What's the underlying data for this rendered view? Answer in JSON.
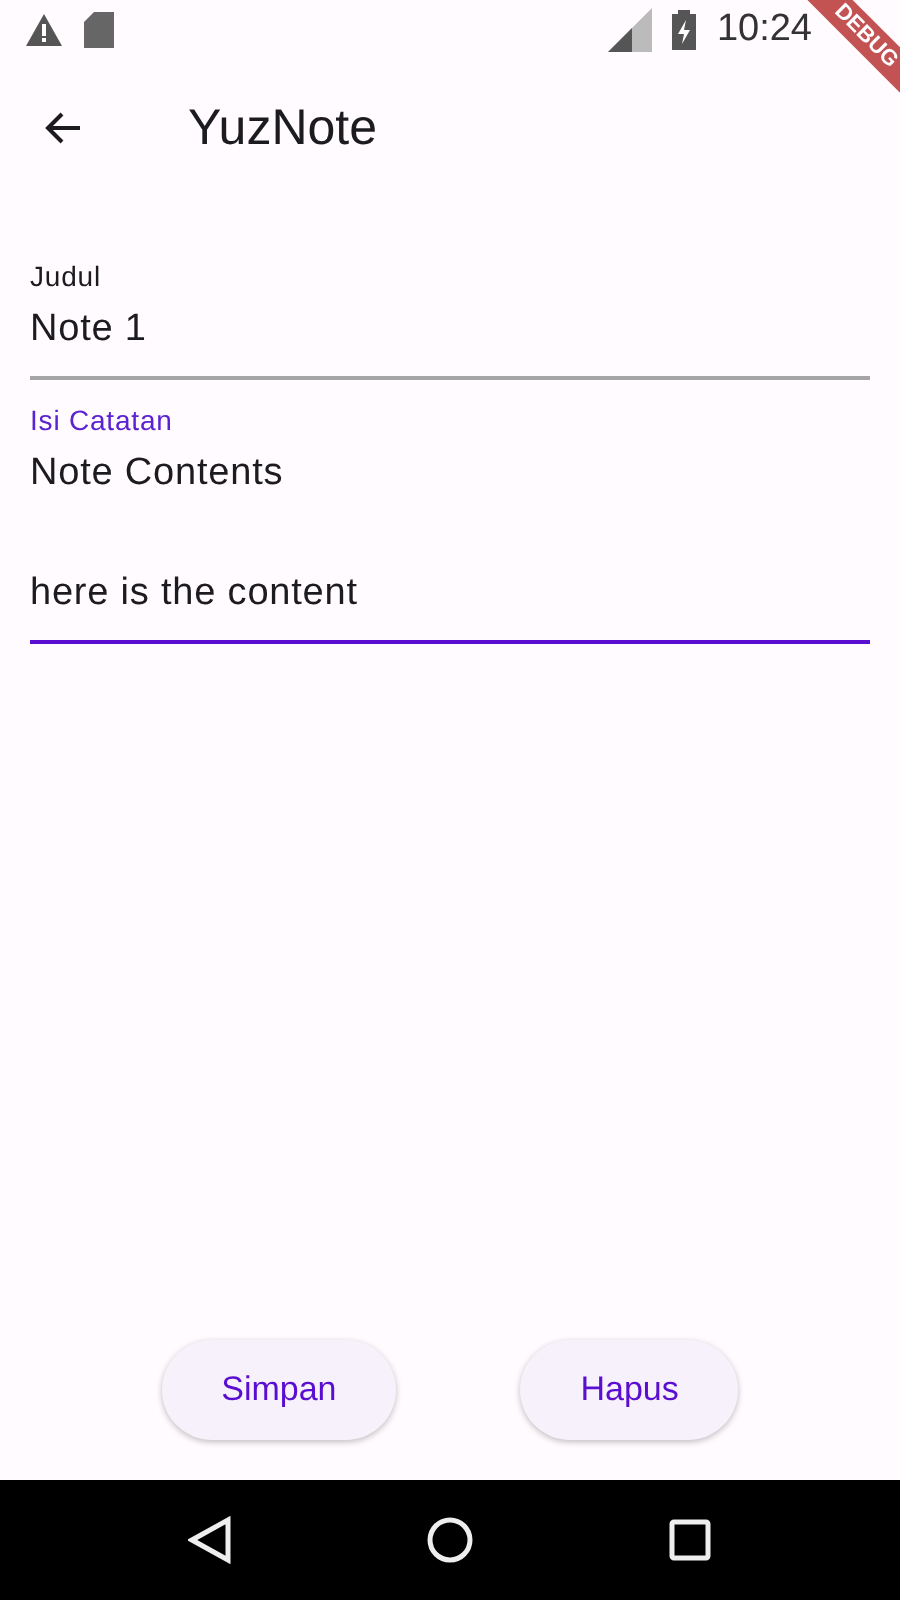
{
  "status_bar": {
    "time": "10:24"
  },
  "debug_banner": "DEBUG",
  "app_bar": {
    "title": "YuzNote"
  },
  "fields": [
    {
      "label": "Judul",
      "value": "Note 1",
      "focused": false
    },
    {
      "label": "Isi Catatan",
      "value": "Note Contents\n\nhere is the content",
      "focused": true
    }
  ],
  "buttons": [
    "Simpan",
    "Hapus"
  ]
}
